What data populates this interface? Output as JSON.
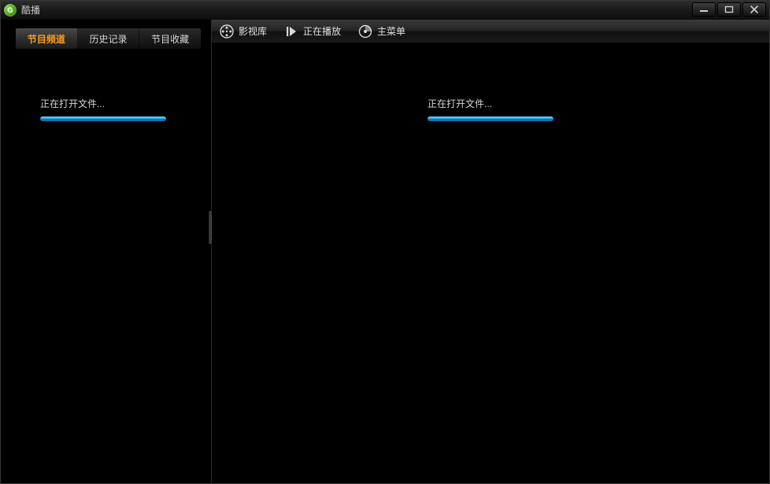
{
  "app": {
    "title": "酷播"
  },
  "window_controls": {
    "min": "minimize",
    "max": "maximize",
    "close": "close"
  },
  "sidebar": {
    "tabs": [
      {
        "label": "节目频道",
        "active": true
      },
      {
        "label": "历史记录",
        "active": false
      },
      {
        "label": "节目收藏",
        "active": false
      }
    ],
    "loading_text": "正在打开文件..."
  },
  "toolbar": {
    "items": [
      {
        "label": "影视库",
        "icon": "film-reel-icon"
      },
      {
        "label": "正在播放",
        "icon": "play-icon"
      },
      {
        "label": "主菜单",
        "icon": "menu-disc-icon"
      }
    ]
  },
  "main": {
    "loading_text": "正在打开文件..."
  }
}
